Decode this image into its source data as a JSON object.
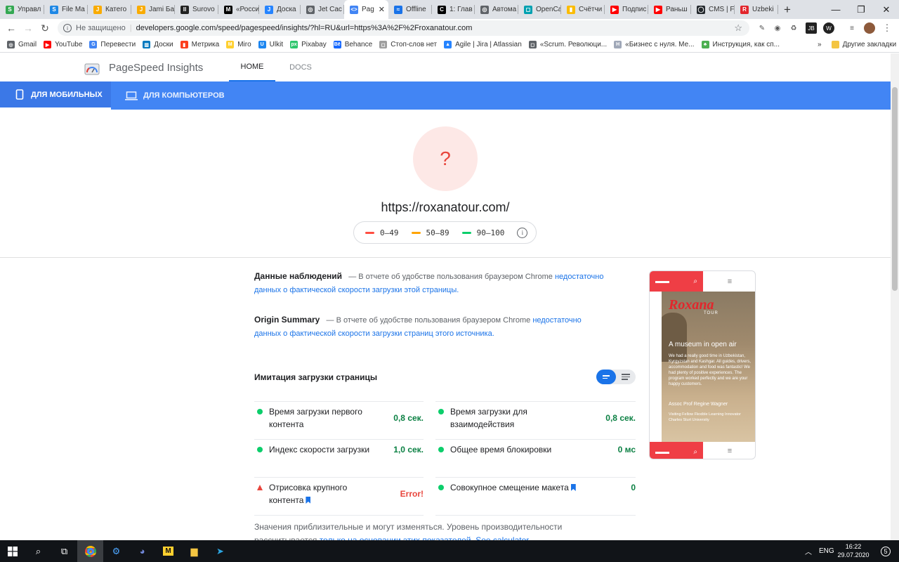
{
  "browser": {
    "tabs": [
      {
        "title": "Управл",
        "color": "#34a853",
        "glyph": "S"
      },
      {
        "title": "File Ma",
        "color": "#1e88e5",
        "glyph": "S"
      },
      {
        "title": "Катего",
        "color": "#f9ab00",
        "glyph": "J"
      },
      {
        "title": "Jami Ба",
        "color": "#f9ab00",
        "glyph": "J"
      },
      {
        "title": "Surovo",
        "color": "#222222",
        "glyph": "II"
      },
      {
        "title": "«Росси",
        "color": "#000000",
        "glyph": "M"
      },
      {
        "title": "Доска",
        "color": "#2684ff",
        "glyph": "J"
      },
      {
        "title": "Jet Cac",
        "color": "#5f6368",
        "glyph": "◎"
      },
      {
        "title": "Pag",
        "color": "#4285f4",
        "glyph": "<>",
        "active": true
      },
      {
        "title": "Offline",
        "color": "#1a73e8",
        "glyph": "≈"
      },
      {
        "title": "1: Глав",
        "color": "#000000",
        "glyph": "C"
      },
      {
        "title": "Автома",
        "color": "#5f6368",
        "glyph": "◎"
      },
      {
        "title": "OpenCa",
        "color": "#00a0b0",
        "glyph": "◻"
      },
      {
        "title": "Счётчи",
        "color": "#fbbc04",
        "glyph": "▮"
      },
      {
        "title": "Подпис",
        "color": "#ff0000",
        "glyph": "▶"
      },
      {
        "title": "Раньш",
        "color": "#ff0000",
        "glyph": "▶"
      },
      {
        "title": "CMS | F",
        "color": "#24292e",
        "glyph": "◯"
      },
      {
        "title": "Uzbeki",
        "color": "#e2262c",
        "glyph": "R"
      }
    ],
    "new_tab": "+",
    "window_controls": {
      "minimize": "—",
      "maximize": "❐",
      "close": "✕"
    },
    "nav": {
      "back": "←",
      "forward": "→",
      "reload": "↻"
    },
    "omnibox": {
      "security": "Не защищено",
      "url": "developers.google.com/speed/pagespeed/insights/?hl=RU&url=https%3A%2F%2Froxanatour.com"
    },
    "bookmarks": [
      {
        "label": "Gmail",
        "color": "#5f6368",
        "glyph": "◎"
      },
      {
        "label": "YouTube",
        "color": "#ff0000",
        "glyph": "▶"
      },
      {
        "label": "Перевести",
        "color": "#4285f4",
        "glyph": "G"
      },
      {
        "label": "Доски",
        "color": "#0079bf",
        "glyph": "▥"
      },
      {
        "label": "Метрика",
        "color": "#fc3f1d",
        "glyph": "▮"
      },
      {
        "label": "Miro",
        "color": "#ffd02f",
        "glyph": "M"
      },
      {
        "label": "Ulkit",
        "color": "#1e87f0",
        "glyph": "U"
      },
      {
        "label": "Pixabay",
        "color": "#2ec66d",
        "glyph": "px"
      },
      {
        "label": "Behance",
        "color": "#1769ff",
        "glyph": "Bē"
      },
      {
        "label": "Стоп-слов нет",
        "color": "#9e9e9e",
        "glyph": "◻"
      },
      {
        "label": "Agile | Jira | Atlassian",
        "color": "#2684ff",
        "glyph": "▲"
      },
      {
        "label": "«Scrum. Революци...",
        "color": "#5f6368",
        "glyph": "◻"
      },
      {
        "label": "«Бизнес с нуля. Ме...",
        "color": "#a0a8b8",
        "glyph": "H"
      },
      {
        "label": "Инструкция, как сп...",
        "color": "#4caf50",
        "glyph": "♣"
      }
    ],
    "bookmarks_more": "»",
    "other_bookmarks": "Другие закладки"
  },
  "psi": {
    "app_name": "PageSpeed Insights",
    "nav": {
      "home": "HOME",
      "docs": "DOCS"
    },
    "device_tabs": {
      "mobile": "ДЛЯ МОБИЛЬНЫХ",
      "desktop": "ДЛЯ КОМПЬЮТЕРОВ"
    },
    "score_glyph": "?",
    "tested_url": "https://roxanatour.com/",
    "legend": [
      {
        "range": "0–49",
        "color": "#ff4e42"
      },
      {
        "range": "50–89",
        "color": "#ffa400"
      },
      {
        "range": "90–100",
        "color": "#0cce6b"
      }
    ],
    "field_data": {
      "title": "Данные наблюдений",
      "dash": "—",
      "text": "В отчете об удобстве пользования браузером Chrome",
      "link": "недостаточно данных о фактической скорости загрузки этой страницы."
    },
    "origin_summary": {
      "title": "Origin Summary",
      "dash": "—",
      "text": "В отчете об удобстве пользования браузером Chrome",
      "link": "недостаточно данных о фактической скорости загрузки страниц этого источника."
    },
    "lab_title": "Имитация загрузки страницы",
    "metrics": [
      {
        "label": "Время загрузки первого контента",
        "value": "0,8 сек.",
        "status": "pass"
      },
      {
        "label": "Время загрузки для взаимодействия",
        "value": "0,8 сек.",
        "status": "pass"
      },
      {
        "label": "Индекс скорости загрузки",
        "value": "1,0 сек.",
        "status": "pass"
      },
      {
        "label": "Общее время блокировки",
        "value": "0 мс",
        "status": "pass"
      },
      {
        "label": "Отрисовка крупного контента",
        "value": "Error!",
        "status": "error"
      },
      {
        "label": "Совокупное смещение макета",
        "value": "0",
        "status": "pass"
      }
    ],
    "status_colors": {
      "pass": "#0cce6b",
      "error": "#e8453c",
      "pass_text": "#0b8043"
    },
    "footnote": {
      "text": "Значения приблизительные и могут изменяться. Уровень производительности рассчитывается",
      "link1": "только на основании этих показателей.",
      "link2": "See calculator."
    },
    "phone_preview": {
      "logo": "Roxana",
      "logo_sub": "TOUR",
      "heading": "A museum in open air",
      "body": "We had a really good time in Uzbekistan, Kyrgyzstan and Kashgar. All guides, drivers, accommodation and food was fantastic! We had plenty of positive experiences. The program worked perfectly and we are your happy customers.",
      "author": "Assoc Prof Regine Wagner",
      "author_role": "Visiting Fellow Flexible Learning Innovator Charles Sturt University"
    }
  },
  "taskbar": {
    "lang": "ENG",
    "time": "16:22",
    "date": "29.07.2020",
    "notifications": "5"
  }
}
